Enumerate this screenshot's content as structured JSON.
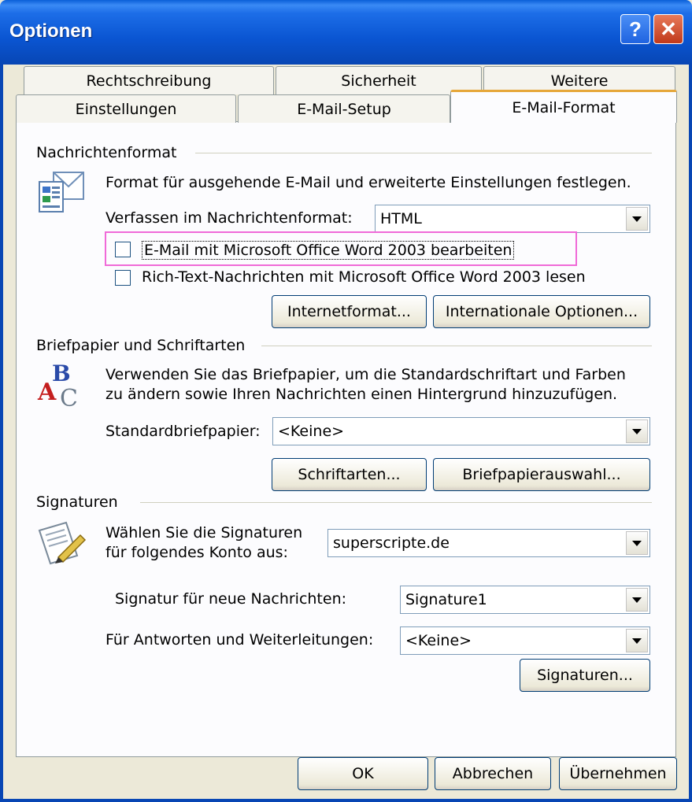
{
  "window": {
    "title": "Optionen"
  },
  "tabs_back": [
    "Rechtschreibung",
    "Sicherheit",
    "Weitere"
  ],
  "tabs_front": [
    "Einstellungen",
    "E-Mail-Setup",
    "E-Mail-Format"
  ],
  "nachrichtenformat": {
    "heading": "Nachrichtenformat",
    "description": "Format für ausgehende E-Mail und erweiterte Einstellungen festlegen.",
    "compose_label": "Verfassen im Nachrichtenformat:",
    "compose_value": "HTML",
    "checkbox_word_edit": "E-Mail mit Microsoft Office Word 2003 bearbeiten",
    "checkbox_word_read": "Rich-Text-Nachrichten mit Microsoft Office Word 2003 lesen",
    "btn_internet": "Internetformat...",
    "btn_international": "Internationale Optionen..."
  },
  "briefpapier": {
    "heading": "Briefpapier und Schriftarten",
    "description_line1": "Verwenden Sie das Briefpapier, um die Standardschriftart und Farben",
    "description_line2": "zu ändern sowie Ihren Nachrichten einen Hintergrund hinzuzufügen.",
    "default_label": "Standardbriefpapier:",
    "default_value": "<Keine>",
    "btn_fonts": "Schriftarten...",
    "btn_stationery": "Briefpapierauswahl..."
  },
  "signaturen": {
    "heading": "Signaturen",
    "account_label_line1": "Wählen Sie die Signaturen",
    "account_label_line2": "für folgendes Konto aus:",
    "account_value": "superscripte.de",
    "new_label": "Signatur für neue Nachrichten:",
    "new_value": "Signature1",
    "reply_label": "Für Antworten und Weiterleitungen:",
    "reply_value": "<Keine>",
    "btn_signatures": "Signaturen..."
  },
  "footer": {
    "ok": "OK",
    "cancel": "Abbrechen",
    "apply": "Übernehmen"
  },
  "colors": {
    "titlebar": "#0a55d2",
    "dialog_bg": "#ece9d8",
    "highlight": "#f06ad8"
  }
}
